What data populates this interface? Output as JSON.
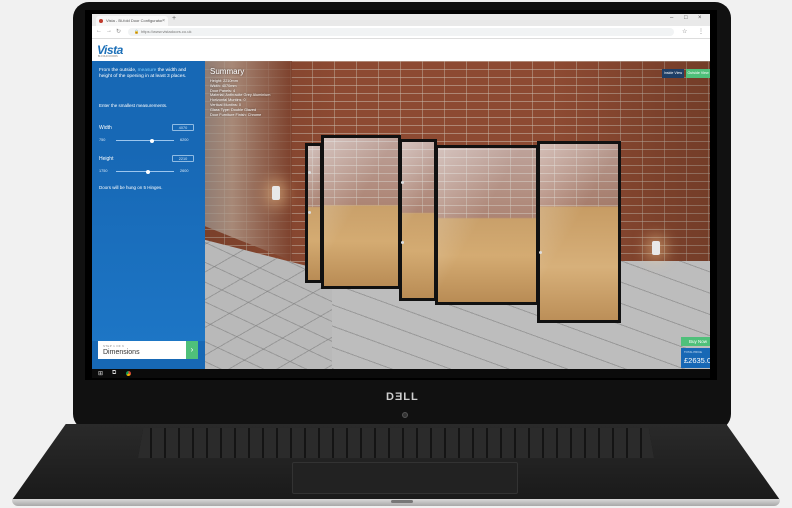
{
  "browser": {
    "tab_title": "Vista - Bi-fold Door Configurator",
    "tab_close": "×",
    "new_tab": "+",
    "url": "https://www.vistadoors.co.uk",
    "win_min": "–",
    "win_max": "□",
    "win_close": "×",
    "back": "←",
    "forward": "→",
    "reload": "↻",
    "lock": "🔒",
    "star": "☆",
    "menu": "⋮"
  },
  "site": {
    "logo": "Vista",
    "logo_sub": "BI-FOLD DOORS"
  },
  "sidebar": {
    "intro_pre": "From the outside, ",
    "intro_hl": "measure",
    "intro_post": " the width and height of the opening in at least 3 places.",
    "hint": "Enter the smallest measurements.",
    "width": {
      "label": "Width",
      "value": "4070",
      "min": "750",
      "max": "6200",
      "level": 0.62
    },
    "height": {
      "label": "Height",
      "value": "2210",
      "min": "1750",
      "max": "2600",
      "level": 0.55
    },
    "note": "Doors will be hung on 5 Hinges.",
    "step_small": "STEP 1 OF 6",
    "step_title": "Dimensions",
    "step_next": "›"
  },
  "summary": {
    "title": "Summary",
    "lines": [
      "Height: 2210mm",
      "Width: 4070mm",
      "Door Panels: 4",
      "Material: Anthracite Grey Aluminium",
      "Horizontal Muntins: 0",
      "Vertical Muntins: 0",
      "Glass Type: Double Glazed",
      "Door Furniture Finish: Chrome"
    ]
  },
  "views": {
    "inside": "Inside View",
    "outside": "Outside View"
  },
  "purchase": {
    "buy": "Buy Now",
    "price_label": "TOTAL PRICE",
    "price": "£2635.00"
  },
  "laptop": {
    "brand": "DƎLL"
  },
  "colors": {
    "accent_blue": "#1768b5",
    "accent_green": "#4fc07a"
  }
}
